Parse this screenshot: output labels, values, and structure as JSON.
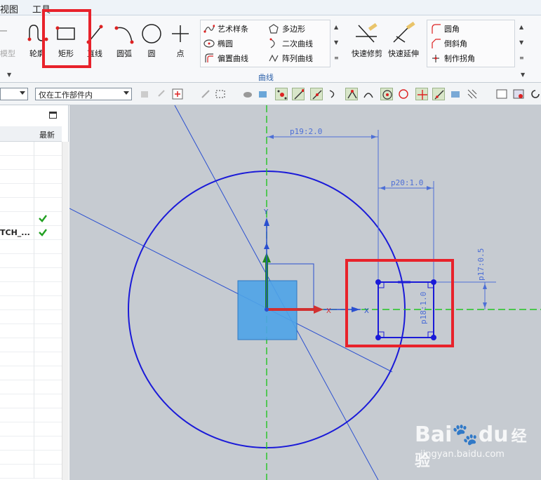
{
  "menu": {
    "items": [
      "视图",
      "工具"
    ]
  },
  "ribbon": {
    "buttons": {
      "profile": "轮廓",
      "rectangle": "矩形",
      "line": "直线",
      "arc": "圆弧",
      "circle": "圆",
      "point": "点",
      "faded": "模型"
    },
    "curve_list": {
      "studio_spline": "艺术样条",
      "ellipse": "椭圆",
      "offset_curve": "偏置曲线",
      "polygon": "多边形",
      "conic": "二次曲线",
      "pattern_curve": "阵列曲线"
    },
    "group_label": "曲线",
    "quick": {
      "trim": "快速修剪",
      "extend": "快速延伸"
    },
    "corner": {
      "fillet": "圆角",
      "chamfer": "倒斜角",
      "make_corner": "制作拐角"
    }
  },
  "toolbar2": {
    "scope_select": "仅在工作部件内"
  },
  "navigator": {
    "column_latest": "最新",
    "rows": [
      {
        "label": "",
        "check": false
      },
      {
        "label": "",
        "check": false
      },
      {
        "label": "",
        "check": false
      },
      {
        "label": "",
        "check": false
      },
      {
        "label": "",
        "check": false
      },
      {
        "label": "",
        "check": true
      },
      {
        "label": "TCH_...",
        "check": true
      }
    ]
  },
  "sketch": {
    "dims": {
      "p19": "p19:2.0",
      "p20": "p20:1.0",
      "p17": "p17:0.5",
      "p18": "p18:1.0"
    },
    "axis_x": "X",
    "axis_y": "Y"
  },
  "watermark": {
    "brand": "Bai",
    "brand2": "du",
    "cn": "经验",
    "url": "jingyan.baidu.com"
  },
  "colors": {
    "highlight": "#e8222b",
    "sketch_blue": "#1a1ad8",
    "dim_blue": "#4d6fd6",
    "axis_green": "#22c422",
    "canvas_bg": "#c6cbd1"
  }
}
